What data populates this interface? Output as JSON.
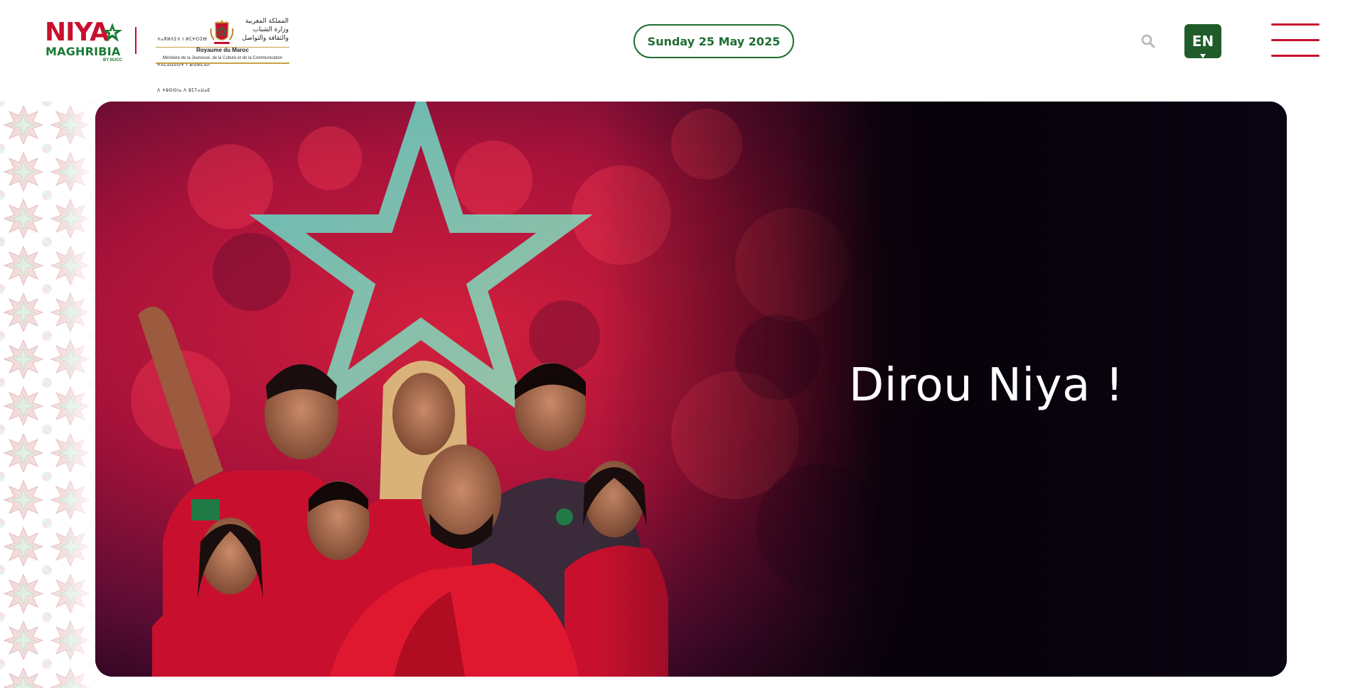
{
  "header": {
    "brand": {
      "name_top": "NIYA",
      "name_bottom": "MAGHRIBIA",
      "by_line": "BY MJCC"
    },
    "ministry": {
      "tifinagh_lines": [
        "ⵜⴰⴳⵍⴷⵉⵜ ⵏ ⵍⵎⵖⵔⵉⴱ",
        "ⵜⴰⵎⴰⵡⴰⵙⵜ ⵏ ⵓⵏⴰⵍⵎⴰⴷ",
        "ⴷ ⵜⵓⵙⵙⵏⴰ ⴷ ⵓⵎⵢⴰⵡⴰⴹ"
      ],
      "arabic_lines": [
        "المملكة المغربية",
        "وزارة الشباب",
        "والثقافة والتواصل"
      ],
      "royaume": "Royaume du Maroc",
      "ministere": "Ministère de la Jeunesse, de la Culture et de la Communication"
    },
    "date_label": "Sunday 25 May 2025",
    "search_icon": "search-icon",
    "language_label": "EN",
    "menu_icon": "hamburger-menu-icon"
  },
  "hero": {
    "title": "Dirou Niya !"
  },
  "colors": {
    "brand_red": "#c8102e",
    "brand_green": "#1b7a34",
    "hero_dark": "#07020a",
    "date_green": "#1f6e33"
  }
}
